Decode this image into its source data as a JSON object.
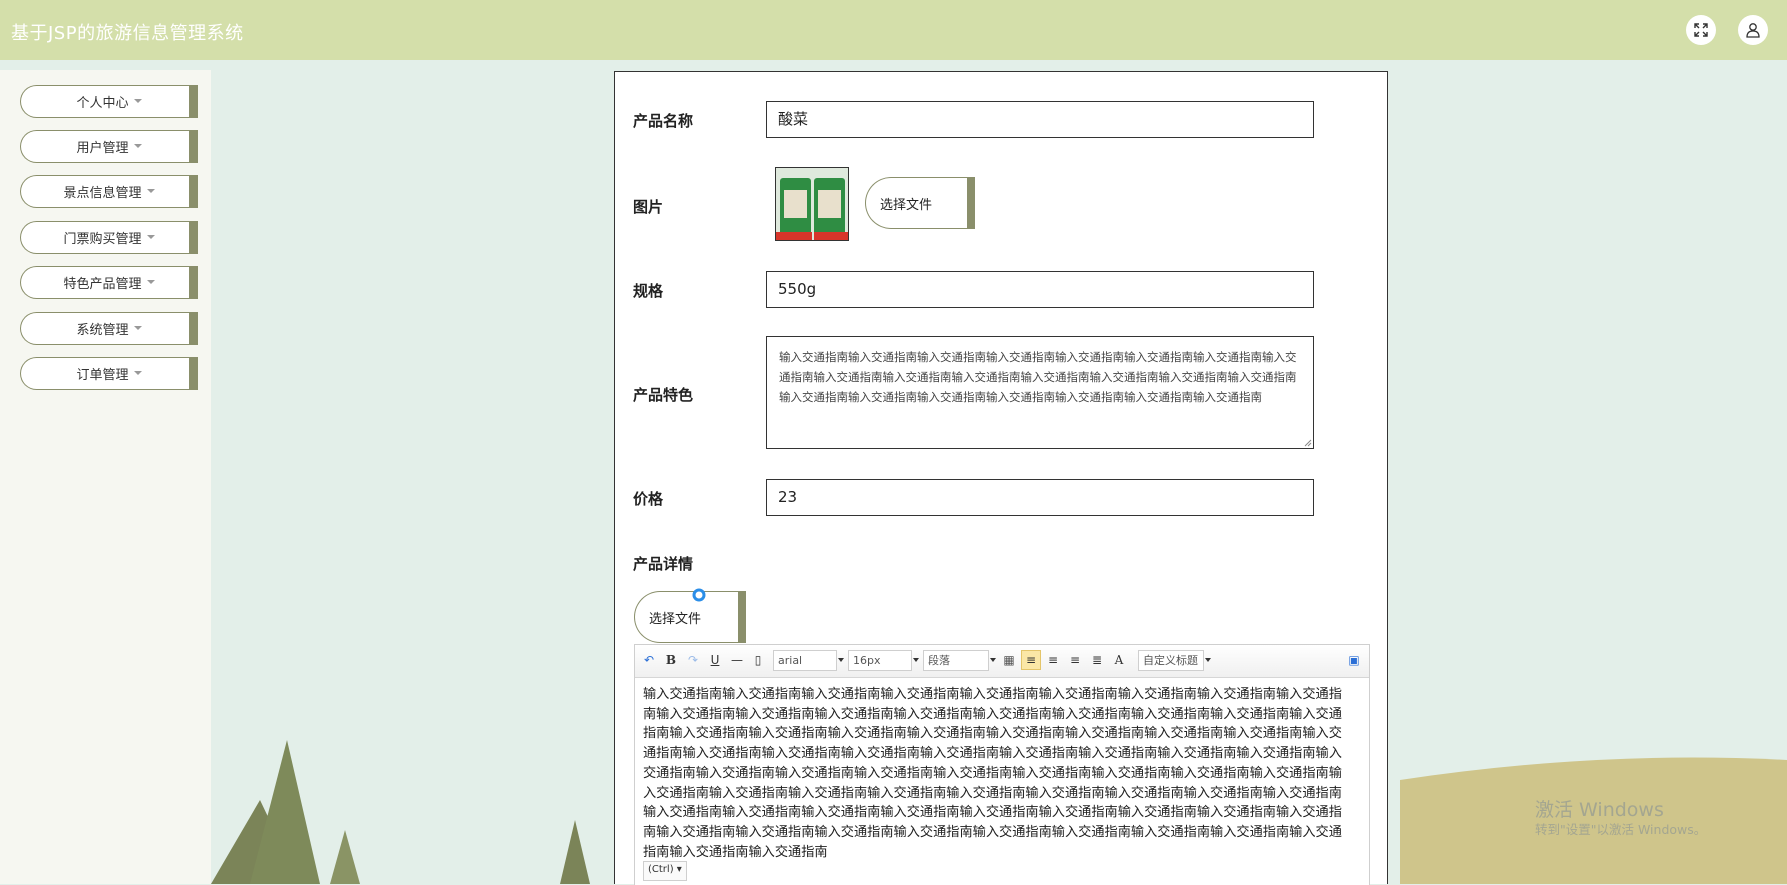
{
  "app": {
    "title": "基于JSP的旅游信息管理系统"
  },
  "header": {
    "fullscreen_icon": "fullscreen-icon",
    "user_icon": "user-icon"
  },
  "sidebar": {
    "items": [
      {
        "label": "个人中心"
      },
      {
        "label": "用户管理"
      },
      {
        "label": "景点信息管理"
      },
      {
        "label": "门票购买管理"
      },
      {
        "label": "特色产品管理"
      },
      {
        "label": "系统管理"
      },
      {
        "label": "订单管理"
      }
    ]
  },
  "form": {
    "product_name": {
      "label": "产品名称",
      "value": "酸菜"
    },
    "image": {
      "label": "图片",
      "file_button": "选择文件"
    },
    "spec": {
      "label": "规格",
      "value": "550g"
    },
    "feature": {
      "label": "产品特色",
      "value": "输入交通指南输入交通指南输入交通指南输入交通指南输入交通指南输入交通指南输入交通指南输入交通指南输入交通指南输入交通指南输入交通指南输入交通指南输入交通指南输入交通指南输入交通指南输入交通指南输入交通指南输入交通指南输入交通指南输入交通指南输入交通指南输入交通指南"
    },
    "price": {
      "label": "价格",
      "value": "23"
    },
    "detail": {
      "label": "产品详情",
      "file_button": "选择文件"
    }
  },
  "editor": {
    "font_family": "arial",
    "font_size": "16px",
    "paragraph": "段落",
    "custom_title": "自定义标题",
    "content": "输入交通指南输入交通指南输入交通指南输入交通指南输入交通指南输入交通指南输入交通指南输入交通指南输入交通指南输入交通指南输入交通指南输入交通指南输入交通指南输入交通指南输入交通指南输入交通指南输入交通指南输入交通指南输入交通指南输入交通指南输入交通指南输入交通指南输入交通指南输入交通指南输入交通指南输入交通指南输入交通指南输入交通指南输入交通指南输入交通指南输入交通指南输入交通指南输入交通指南输入交通指南输入交通指南输入交通指南输入交通指南输入交通指南输入交通指南输入交通指南输入交通指南输入交通指南输入交通指南输入交通指南输入交通指南输入交通指南输入交通指南输入交通指南输入交通指南输入交通指南输入交通指南输入交通指南输入交通指南输入交通指南输入交通指南输入交通指南输入交通指南输入交通指南输入交通指南输入交通指南输入交通指南输入交通指南输入交通指南输入交通指南输入交通指南输入交通指南输入交通指南输入交通指南输入交通指南输入交通指南输入交通指南输入交通指南输入交通指南",
    "paste_tag": "(Ctrl)"
  },
  "watermark": {
    "line1": "激活 Windows",
    "line2": "转到\"设置\"以激活 Windows。"
  },
  "colors": {
    "header_bg": "#d4dfaa",
    "accent": "#8a8f6b",
    "page_bg": "#e3efe9"
  }
}
